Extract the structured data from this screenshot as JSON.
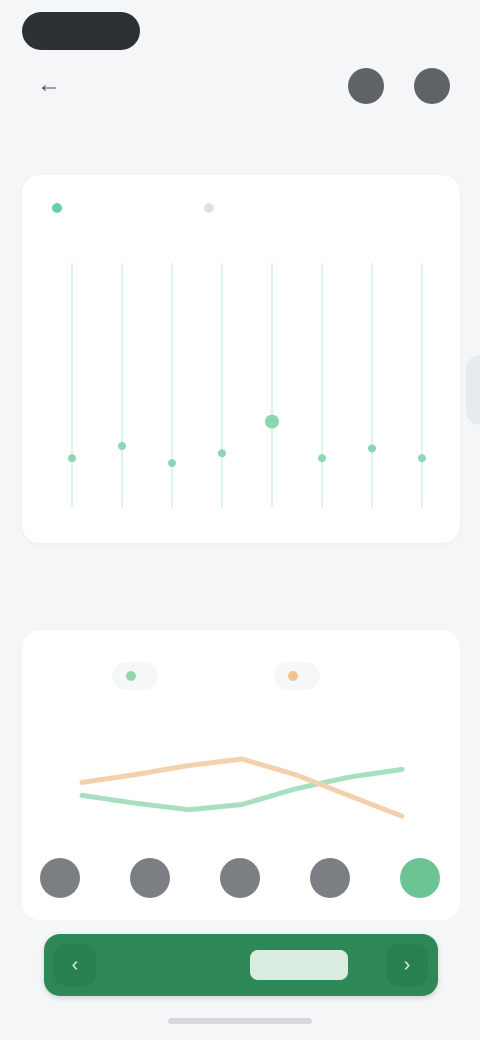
{
  "status": {
    "time": "",
    "signal_text": ""
  },
  "header": {
    "back_glyph": "←"
  },
  "sections": {
    "first_title": "",
    "second_title": "",
    "see_all": ""
  },
  "card1": {
    "legend": [
      {
        "label": "",
        "color": "#66d1a0"
      },
      {
        "label": "",
        "color": "#e7e2dc"
      }
    ]
  },
  "card2": {
    "legend": [
      {
        "label": "",
        "color": "#8fd6af"
      },
      {
        "label": "",
        "color": "#f2c28f"
      }
    ]
  },
  "cta": {
    "label": "",
    "chip": "",
    "left_glyph": "‹",
    "right_glyph": "›"
  },
  "chart_data": [
    {
      "type": "line",
      "series_orientation": "vertical",
      "categories": [
        "",
        "",
        "",
        "",
        "",
        "",
        "",
        ""
      ],
      "series": [
        {
          "values": [
            0.2,
            0.25,
            0.18,
            0.22,
            0.35,
            0.2,
            0.24,
            0.2
          ]
        }
      ],
      "grid": true,
      "legend": "top-left"
    },
    {
      "type": "line",
      "x": [
        0,
        1,
        2,
        3,
        4,
        5,
        6
      ],
      "series": [
        {
          "values": [
            0.42,
            0.36,
            0.31,
            0.35,
            0.47,
            0.56,
            0.62
          ]
        },
        {
          "values": [
            0.52,
            0.58,
            0.65,
            0.7,
            0.58,
            0.42,
            0.26
          ]
        }
      ],
      "grid": false,
      "legend": "top"
    }
  ]
}
